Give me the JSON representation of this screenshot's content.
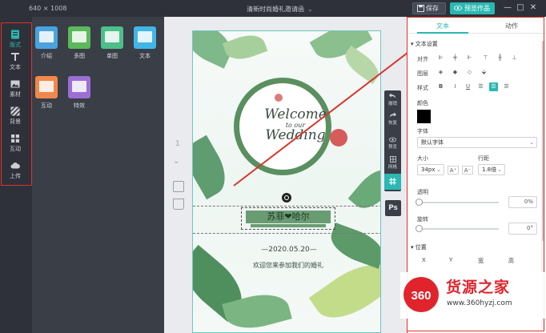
{
  "topbar": {
    "canvas_size": "640 × 1008",
    "doc_title": "清新时尚婚礼邀请函",
    "save_label": "保存",
    "preview_label": "预览作品"
  },
  "rail": {
    "items": [
      {
        "label": "版式",
        "icon": "layout-icon",
        "active": true
      },
      {
        "label": "文本",
        "icon": "text-icon"
      },
      {
        "label": "素材",
        "icon": "image-icon"
      },
      {
        "label": "背景",
        "icon": "background-icon"
      },
      {
        "label": "互动",
        "icon": "grid-icon"
      },
      {
        "label": "上传",
        "icon": "cloud-upload-icon"
      }
    ]
  },
  "panel": {
    "components": [
      {
        "label": "介绍",
        "color": "#4aa3df"
      },
      {
        "label": "多图",
        "color": "#5cb85c"
      },
      {
        "label": "单图",
        "color": "#4cbf8a"
      },
      {
        "label": "文本",
        "color": "#41b6e6"
      },
      {
        "label": "互动",
        "color": "#f0884a"
      },
      {
        "label": "特效",
        "color": "#9b6fd6"
      }
    ]
  },
  "canvas": {
    "page_number": "1",
    "welcome_line1": "Welcome",
    "welcome_line2": "to our",
    "welcome_line3": "Wedding",
    "names": "苏菲❤哈尔",
    "date": "—2020.05.20—",
    "invite_text": "欢迎您来参加我们的婚礼"
  },
  "tools": [
    {
      "label": "撤销",
      "icon": "undo-icon"
    },
    {
      "label": "恢复",
      "icon": "redo-icon"
    },
    {
      "label": "预览",
      "icon": "eye-icon"
    },
    {
      "label": "网格",
      "icon": "grid-icon"
    },
    {
      "label": "",
      "icon": "hash-icon",
      "active": true
    }
  ],
  "ps_label": "Ps",
  "props": {
    "tab_text": "文本",
    "tab_animation": "动作",
    "section_text_settings": "▾ 文本设置",
    "align_label": "对齐",
    "layer_label": "图层",
    "style_label": "样式",
    "color_label": "颜色",
    "font_label": "字体",
    "font_value": "默认字体",
    "size_label": "大小",
    "size_value": "34px",
    "line_height_label": "行距",
    "line_height_value": "1.8倍",
    "opacity_label": "透明",
    "opacity_value": "0%",
    "rotate_label": "旋转",
    "rotate_value": "0°",
    "section_position": "▾ 位置",
    "pos_x": "X",
    "pos_y": "Y",
    "pos_w": "宽",
    "pos_h": "高",
    "text_color": "#000000",
    "accent": "#2bb8b2"
  },
  "watermark": {
    "badge": "360",
    "name": "货源之家",
    "url": "www.360hyzj.com"
  }
}
